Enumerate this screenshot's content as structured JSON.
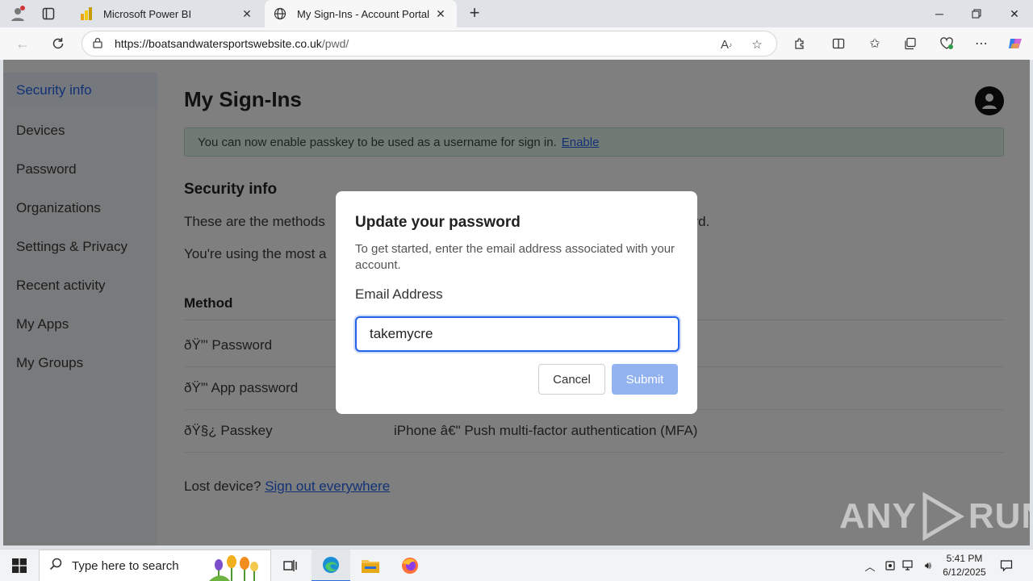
{
  "browser": {
    "tabs": [
      {
        "title": "Microsoft Power BI",
        "active": false
      },
      {
        "title": "My Sign-Ins - Account Portal",
        "active": true
      }
    ],
    "url_host": "https://boatsandwatersportswebsite.co.uk",
    "url_path": "/pwd/"
  },
  "sidebar": {
    "items": [
      {
        "label": "Security info",
        "active": true
      },
      {
        "label": "Devices"
      },
      {
        "label": "Password"
      },
      {
        "label": "Organizations"
      },
      {
        "label": "Settings & Privacy"
      },
      {
        "label": "Recent activity"
      },
      {
        "label": "My Apps"
      },
      {
        "label": "My Groups"
      }
    ]
  },
  "main": {
    "title": "My Sign-Ins",
    "banner_text": "You can now enable passkey to be used as a username for sign in.",
    "banner_link": "Enable",
    "section_title": "Security info",
    "para1_start": "These are the methods",
    "para1_end": "ord.",
    "para2_start": "You're using the most a",
    "method_header": "Method",
    "methods": [
      {
        "name": "ðŸ”' Password",
        "detail": ""
      },
      {
        "name": "ðŸ”' App password",
        "detail": ""
      },
      {
        "name": "ðŸ§¿ Passkey",
        "detail": "iPhone â€\" Push multi-factor authentication (MFA)"
      }
    ],
    "lost_text": "Lost device?",
    "lost_link": "Sign out everywhere"
  },
  "modal": {
    "title": "Update your password",
    "description": "To get started, enter the email address associated with your account.",
    "email_label": "Email Address",
    "email_value": "takemycre",
    "cancel_label": "Cancel",
    "submit_label": "Submit"
  },
  "watermark": {
    "left": "ANY",
    "right": "RUN"
  },
  "taskbar": {
    "search_placeholder": "Type here to search",
    "time": "5:41 PM",
    "date": "6/12/2025"
  }
}
